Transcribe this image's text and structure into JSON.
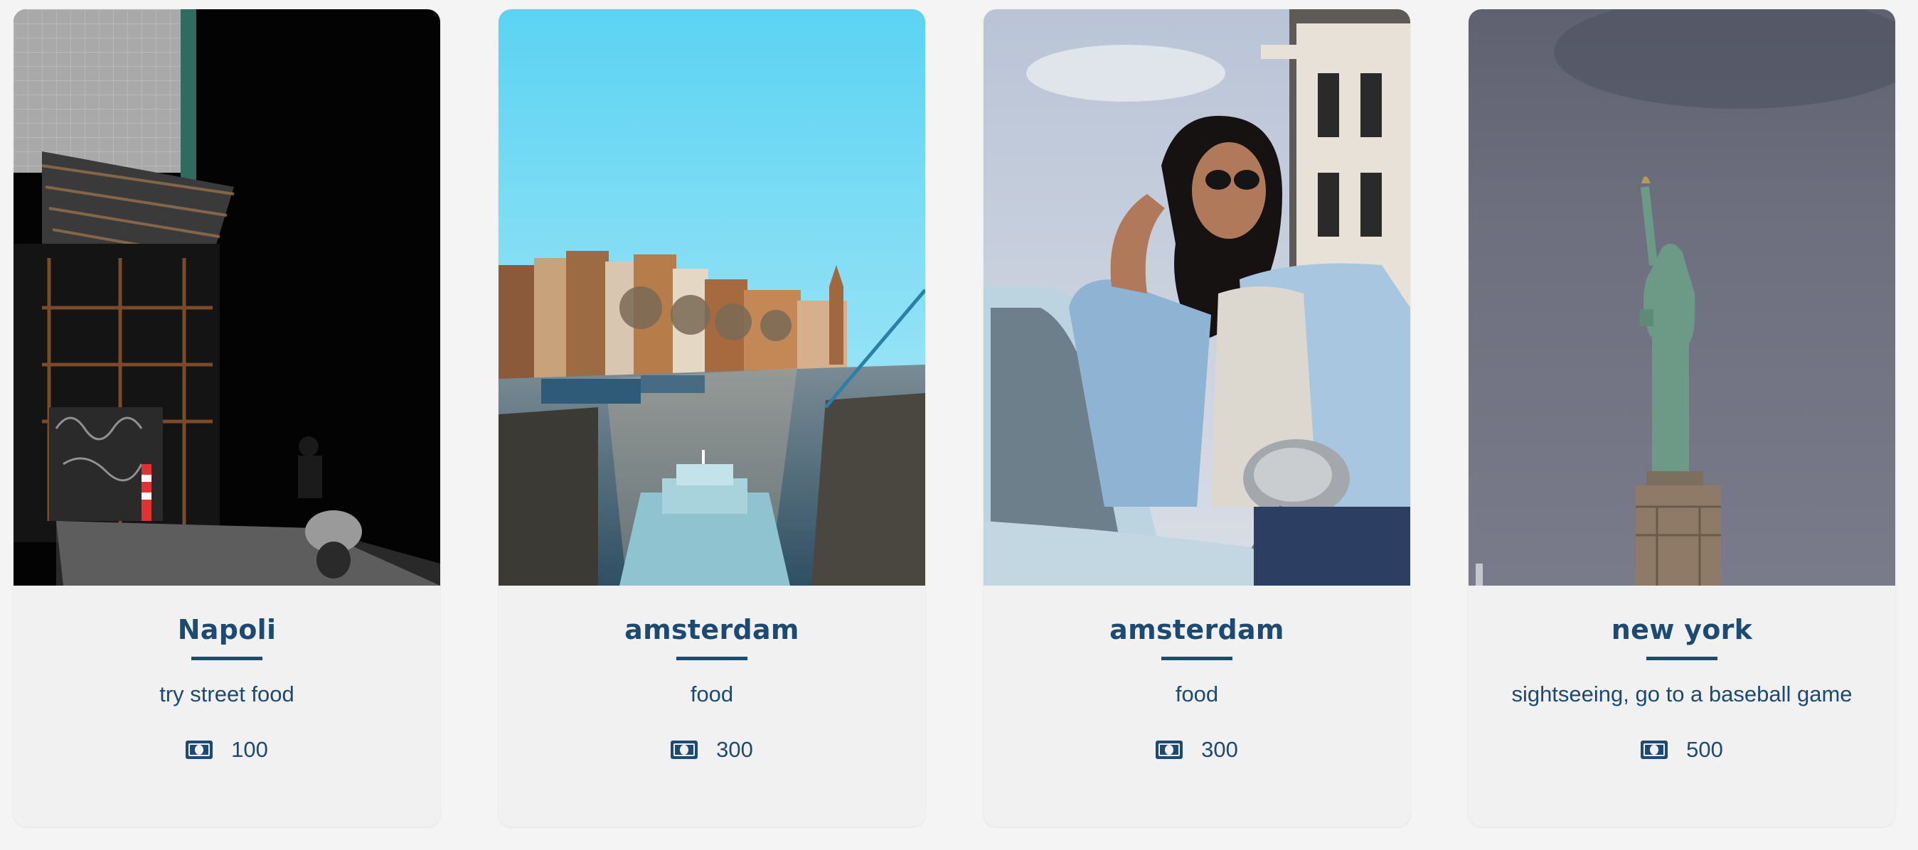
{
  "cards": [
    {
      "title": "Napoli",
      "description": "try street food",
      "price": "100",
      "price_icon": "money-bill-icon",
      "photo": "dark-street-scaffolding-scooter"
    },
    {
      "title": "amsterdam",
      "description": "food",
      "price": "300",
      "price_icon": "money-bill-icon",
      "photo": "amsterdam-canal-boat"
    },
    {
      "title": "amsterdam",
      "description": "food",
      "price": "300",
      "price_icon": "money-bill-icon",
      "photo": "woman-sunglasses-vintage-car"
    },
    {
      "title": "new york",
      "description": "sightseeing, go to a baseball game",
      "price": "500",
      "price_icon": "money-bill-icon",
      "photo": "statue-of-liberty-grey-sky"
    }
  ],
  "colors": {
    "text": "#1d4a72",
    "card_bg": "#f1f1f1",
    "page_bg": "#f4f4f4"
  }
}
